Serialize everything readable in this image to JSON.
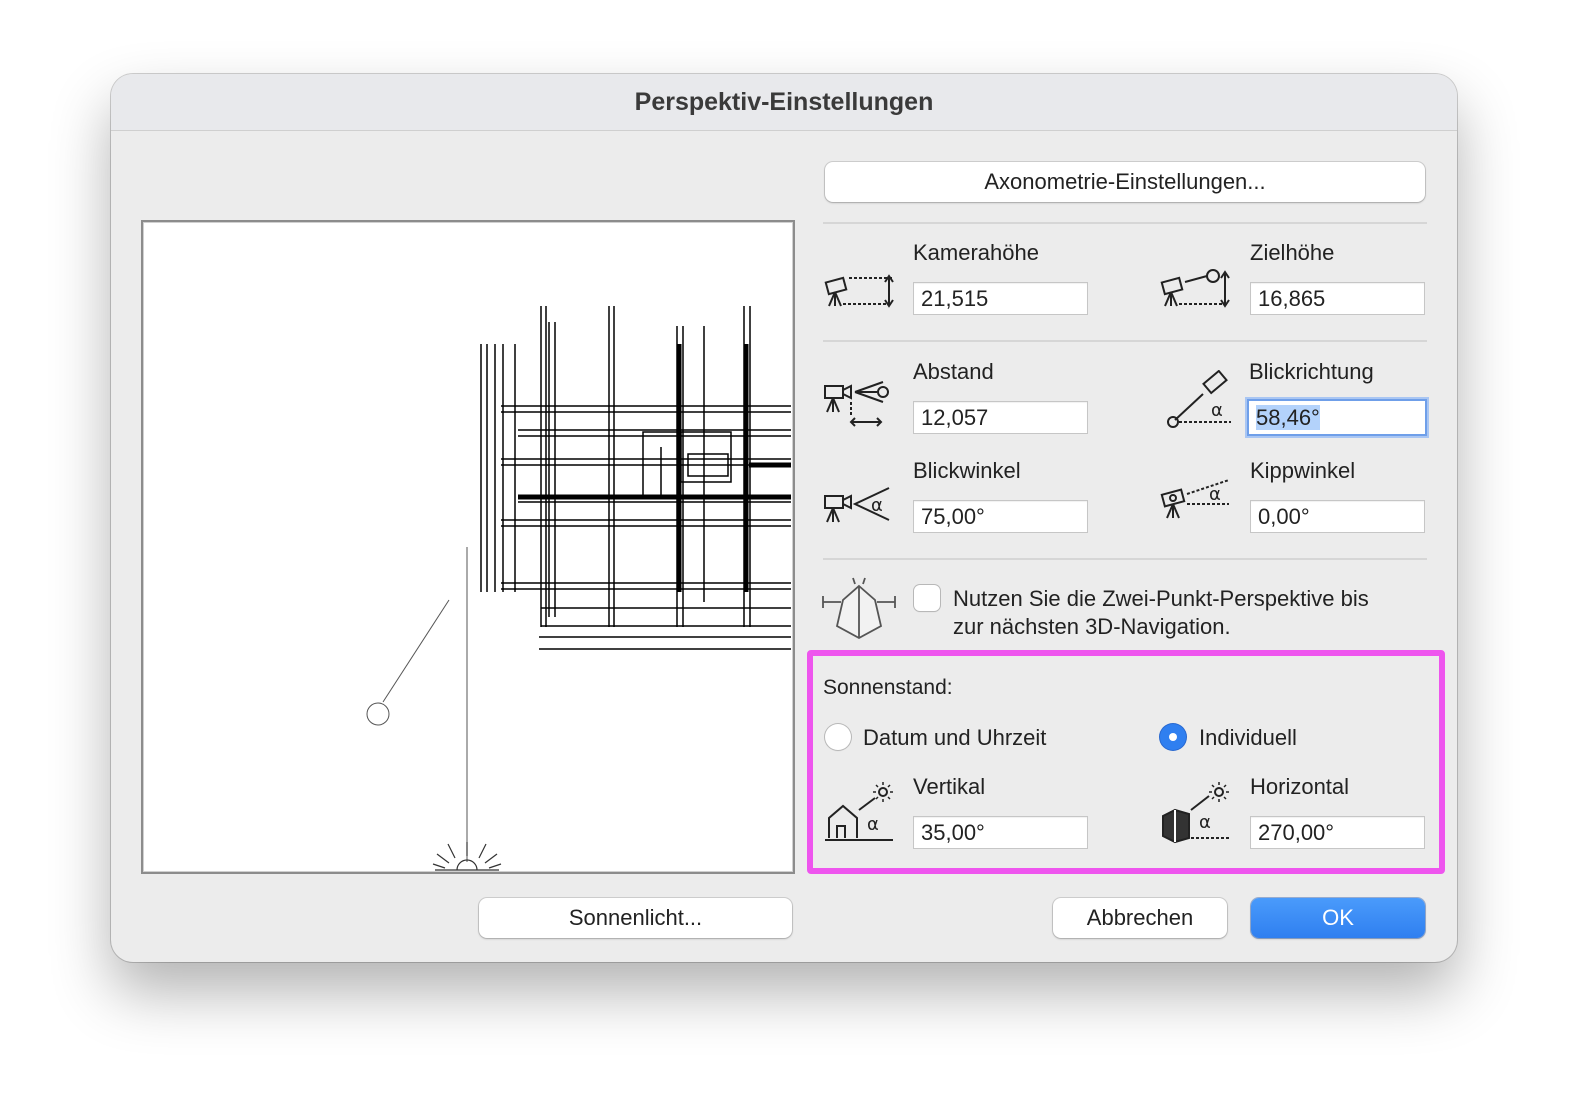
{
  "dialog": {
    "title": "Perspektiv-Einstellungen",
    "axonometry_button": "Axonometrie-Einstellungen...",
    "sunlight_button": "Sonnenlicht...",
    "cancel_button": "Abbrechen",
    "ok_button": "OK"
  },
  "camera": {
    "camera_height": {
      "label": "Kamerahöhe",
      "value": "21,515"
    },
    "target_height": {
      "label": "Zielhöhe",
      "value": "16,865"
    },
    "distance": {
      "label": "Abstand",
      "value": "12,057"
    },
    "view_direction": {
      "label": "Blickrichtung",
      "value": "58,46°"
    },
    "view_angle": {
      "label": "Blickwinkel",
      "value": "75,00°"
    },
    "tilt_angle": {
      "label": "Kippwinkel",
      "value": "0,00°"
    }
  },
  "two_point": {
    "checked": false,
    "line1": "Nutzen Sie die Zwei-Punkt-Perspektive bis",
    "line2": "zur nächsten 3D-Navigation."
  },
  "sun": {
    "heading": "Sonnenstand:",
    "option_date": "Datum und Uhrzeit",
    "option_custom": "Individuell",
    "selected": "Individuell",
    "vertical": {
      "label": "Vertikal",
      "value": "35,00°"
    },
    "horizontal": {
      "label": "Horizontal",
      "value": "270,00°"
    }
  },
  "icons": {
    "camera_height": "camera-height-icon",
    "target_height": "target-height-icon",
    "distance": "camera-distance-icon",
    "view_direction": "view-direction-icon",
    "view_angle": "view-angle-icon",
    "tilt_angle": "tilt-angle-icon",
    "two_point": "two-point-perspective-icon",
    "sun_vertical": "sun-altitude-icon",
    "sun_horizontal": "sun-azimuth-icon"
  },
  "colors": {
    "accent": "#2f7ff0",
    "highlight": "#ee55ee",
    "window_bg": "#ececec"
  }
}
